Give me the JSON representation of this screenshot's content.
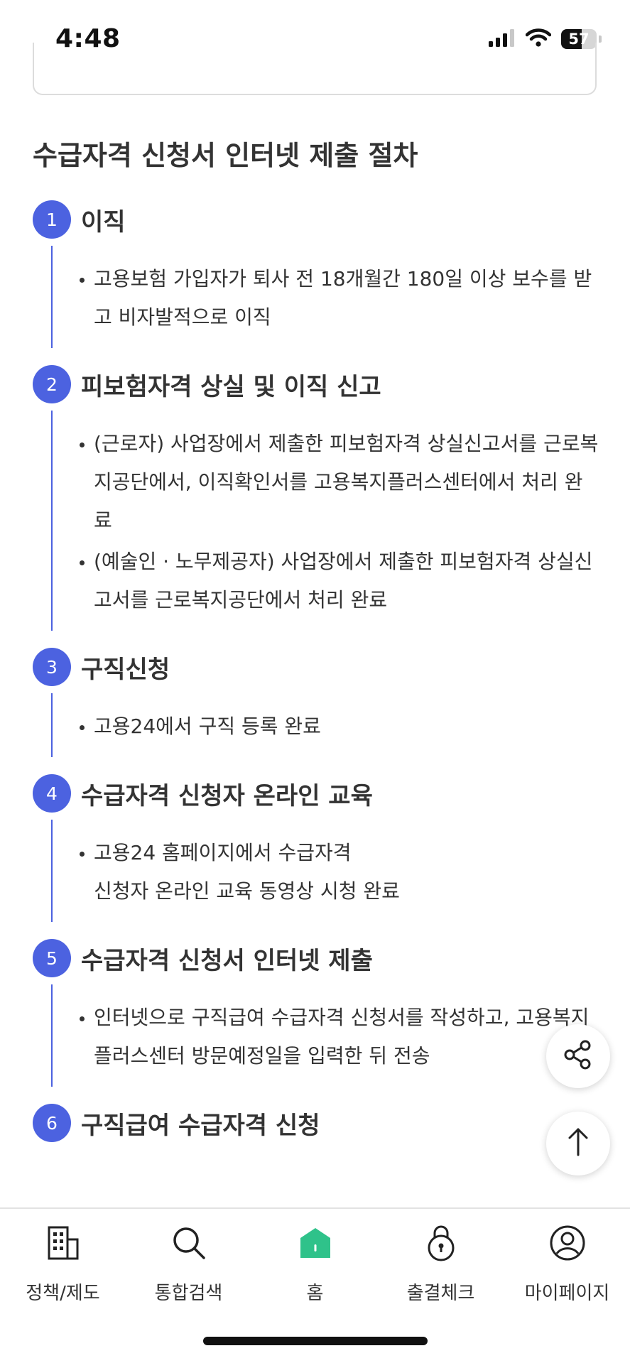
{
  "status_bar": {
    "time": "4:48",
    "battery": "57",
    "battery_level": 0.57
  },
  "section": {
    "title": "수급자격 신청서 인터넷 제출 절차"
  },
  "steps": [
    {
      "number": "1",
      "title": "이직",
      "bullets": [
        "고용보험 가입자가 퇴사 전 18개월간 180일 이상 보수를 받고 비자발적으로 이직"
      ]
    },
    {
      "number": "2",
      "title": "피보험자격 상실 및 이직 신고",
      "bullets": [
        "(근로자) 사업장에서 제출한 피보험자격 상실신고서를 근로복지공단에서, 이직확인서를 고용복지플러스센터에서 처리 완료",
        "(예술인 · 노무제공자) 사업장에서 제출한 피보험자격 상실신고서를 근로복지공단에서 처리 완료"
      ]
    },
    {
      "number": "3",
      "title": "구직신청",
      "bullets": [
        "고용24에서 구직 등록 완료"
      ]
    },
    {
      "number": "4",
      "title": "수급자격 신청자 온라인 교육",
      "bullets": [
        "고용24 홈페이지에서 수급자격\n신청자 온라인 교육 동영상 시청 완료"
      ]
    },
    {
      "number": "5",
      "title": "수급자격 신청서 인터넷 제출",
      "bullets": [
        "인터넷으로 구직급여 수급자격 신청서를 작성하고, 고용복지플러스센터 방문예정일을 입력한 뒤 전송"
      ]
    },
    {
      "number": "6",
      "title": "구직급여 수급자격 신청",
      "bullets": []
    }
  ],
  "bottom_nav": {
    "items": [
      {
        "label": "정책/제도",
        "icon": "building-icon"
      },
      {
        "label": "통합검색",
        "icon": "search-icon"
      },
      {
        "label": "홈",
        "icon": "home-icon"
      },
      {
        "label": "출결체크",
        "icon": "lock-icon"
      },
      {
        "label": "마이페이지",
        "icon": "user-icon"
      }
    ]
  },
  "colors": {
    "accent": "#4c62e0",
    "home": "#2fc28a",
    "text": "#333333"
  }
}
